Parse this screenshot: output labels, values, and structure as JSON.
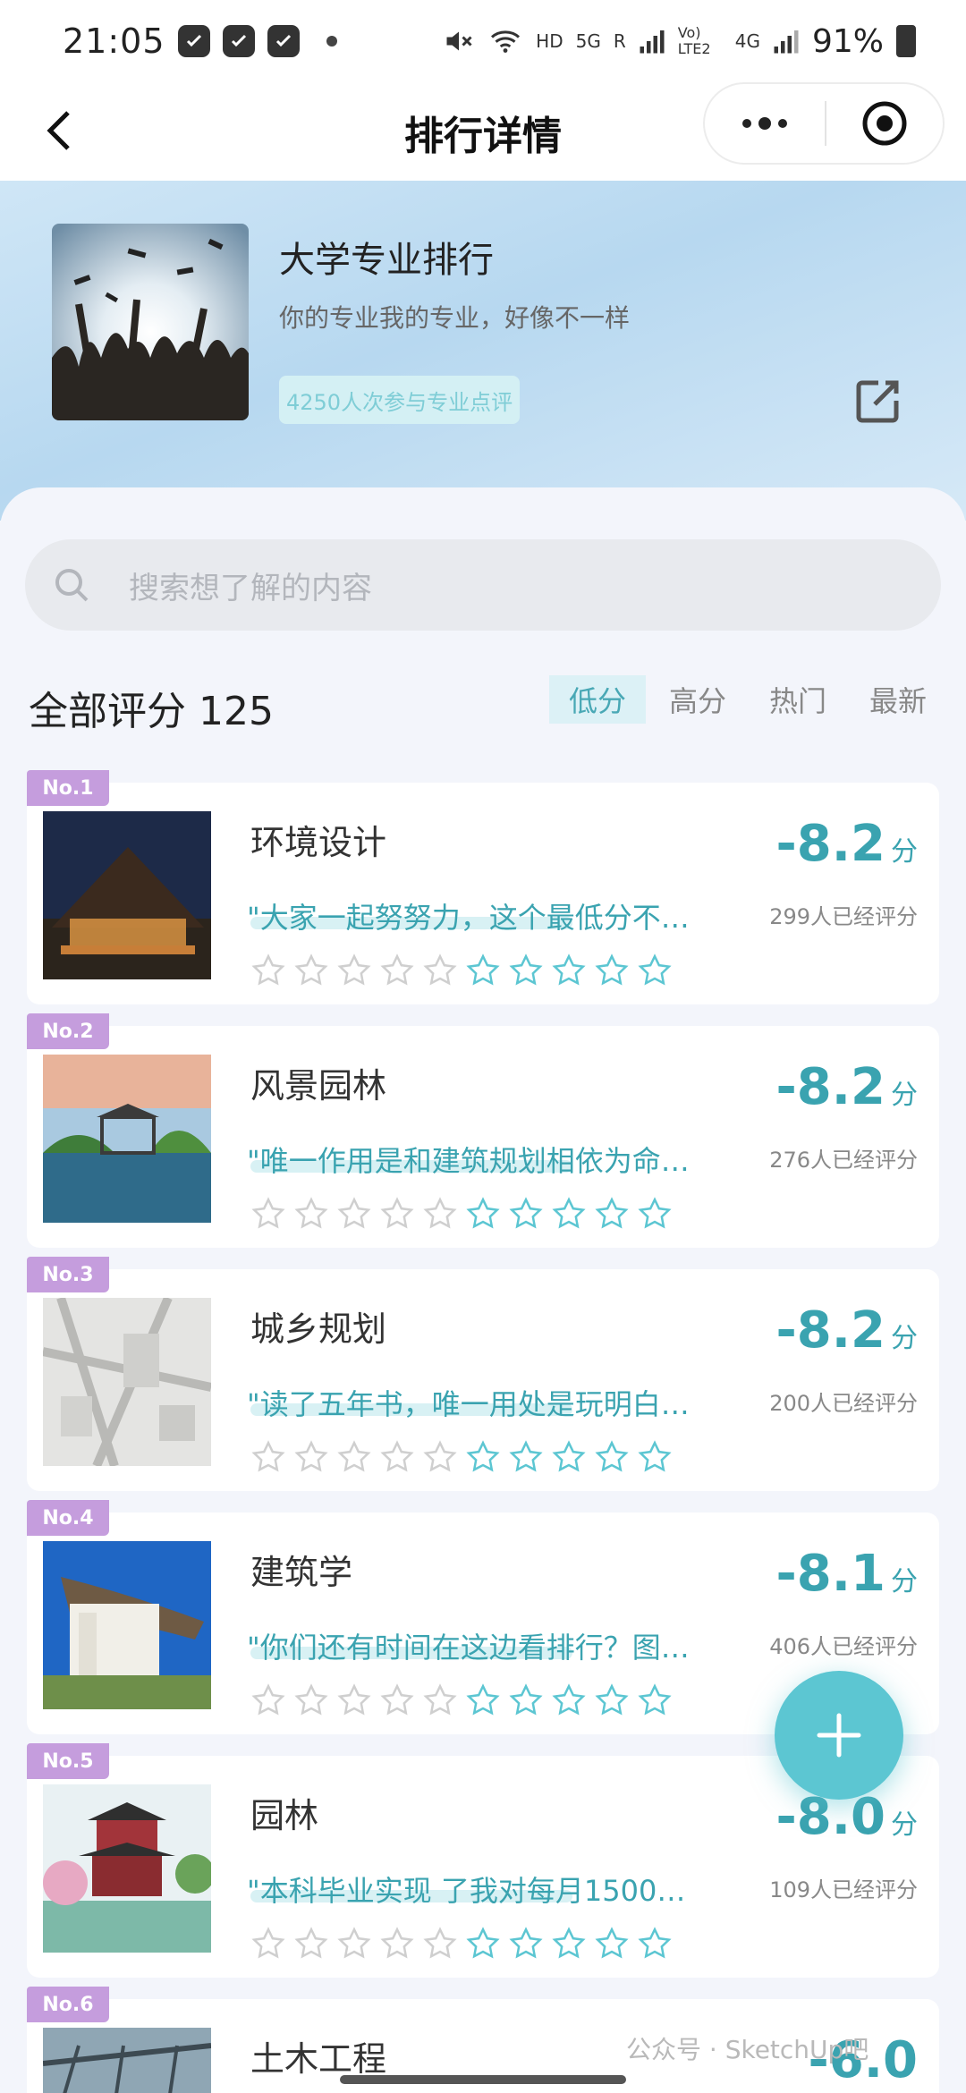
{
  "status_bar": {
    "time": "21:05",
    "right_labels": [
      "HD",
      "5G",
      "R",
      "Vo) LTE2",
      "4G"
    ],
    "battery": "91%"
  },
  "nav": {
    "title": "排行详情",
    "back_icon": "chevron-left-icon",
    "more_icon": "more-dots-icon",
    "close_icon": "target-close-icon"
  },
  "hero": {
    "title": "大学专业排行",
    "subtitle": "你的专业我的专业，好像不一样",
    "badge": "4250人次参与专业点评",
    "share_icon": "share-icon"
  },
  "search": {
    "placeholder": "搜索想了解的内容"
  },
  "filter": {
    "total_label": "全部评分 125",
    "tabs": [
      {
        "label": "低分",
        "active": true
      },
      {
        "label": "高分",
        "active": false
      },
      {
        "label": "热门",
        "active": false
      },
      {
        "label": "最新",
        "active": false
      }
    ]
  },
  "items": [
    {
      "rank": "No.1",
      "name": "环境设计",
      "quote": "\"大家一起努努力，这个最低分不…",
      "score": "-8.2",
      "unit": "分",
      "count": "299人已经评分"
    },
    {
      "rank": "No.2",
      "name": "风景园林",
      "quote": "\"唯一作用是和建筑规划相依为命…",
      "score": "-8.2",
      "unit": "分",
      "count": "276人已经评分"
    },
    {
      "rank": "No.3",
      "name": "城乡规划",
      "quote": "\"读了五年书，唯一用处是玩明白…",
      "score": "-8.2",
      "unit": "分",
      "count": "200人已经评分"
    },
    {
      "rank": "No.4",
      "name": "建筑学",
      "quote": "\"你们还有时间在这边看排行？图…",
      "score": "-8.1",
      "unit": "分",
      "count": "406人已经评分"
    },
    {
      "rank": "No.5",
      "name": "园林",
      "quote": "\"本科毕业实现 了我对每月1500…",
      "score": "-8.0",
      "unit": "分",
      "count": "109人已经评分"
    },
    {
      "rank": "No.6",
      "name": "土木工程",
      "quote": "",
      "score": "-6.0",
      "unit": "",
      "count": ""
    }
  ],
  "fab": {
    "icon": "plus-icon"
  },
  "watermark": "公众号 · SketchUp吧",
  "colors": {
    "accent": "#3aa3b0",
    "rank_badge": "#c59ddd",
    "fab": "#5cc6d2"
  }
}
